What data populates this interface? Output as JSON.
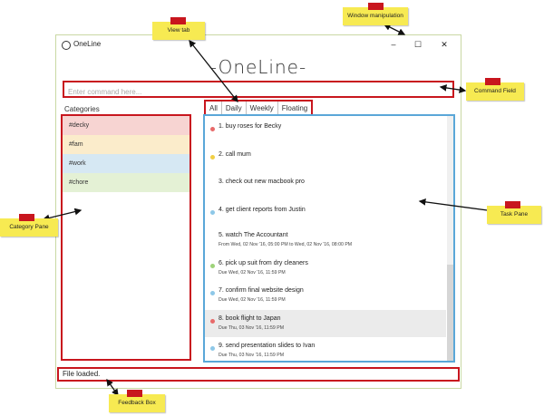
{
  "window": {
    "title": "OneLine",
    "minimize": "–",
    "maximize": "☐",
    "close": "✕"
  },
  "logo": "-OneLine-",
  "command": {
    "placeholder": "Enter command here..."
  },
  "categories": {
    "label": "Categories",
    "items": [
      {
        "name": "#decky",
        "color": "#f7d4d2"
      },
      {
        "name": "#fam",
        "color": "#fbeccb"
      },
      {
        "name": "#work",
        "color": "#d6e8f3"
      },
      {
        "name": "#chore",
        "color": "#e4f1d5"
      }
    ]
  },
  "tabs": [
    "All",
    "Daily",
    "Weekly",
    "Floating"
  ],
  "tasks": [
    {
      "name": "1. buy roses for Becky",
      "sub": "",
      "dot": "#e86a6a"
    },
    {
      "name": "2. call mum",
      "sub": "",
      "dot": "#f1cf44"
    },
    {
      "name": "3. check out new macbook pro",
      "sub": "",
      "dot": ""
    },
    {
      "name": "4. get client reports from Justin",
      "sub": "",
      "dot": "#8ec8e8"
    },
    {
      "name": "5. watch The Accountant",
      "sub": "From Wed, 02 Nov '16, 05:00 PM to Wed, 02 Nov '16, 08:00 PM",
      "dot": ""
    },
    {
      "name": "6. pick up suit from dry cleaners",
      "sub": "Due Wed, 02 Nov '16, 11:59 PM",
      "dot": "#9ed37a"
    },
    {
      "name": "7. confirm final website design",
      "sub": "Due Wed, 02 Nov '16, 11:59 PM",
      "dot": "#8ec8e8"
    },
    {
      "name": "8. book flight to Japan",
      "sub": "Due Thu, 03 Nov '16, 11:59 PM",
      "dot": "#e86a6a"
    },
    {
      "name": "9. send presentation slides to Ivan",
      "sub": "Due Thu, 03 Nov '16, 11:59 PM",
      "dot": "#8ec8e8"
    }
  ],
  "feedback": "File loaded.",
  "callouts": {
    "view_tab": "View tab",
    "window_manipulation": "Window manipulation",
    "command_field": "Command Field",
    "category_pane": "Category Pane",
    "task_pane": "Task Pane",
    "feedback_box": "Feedback Box"
  }
}
